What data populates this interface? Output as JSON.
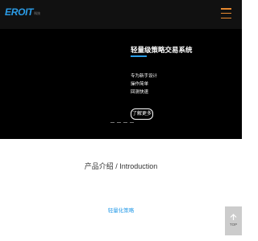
{
  "header": {
    "logo_text": "EROIT",
    "logo_sub": "科技"
  },
  "hero": {
    "title": "轻量级策略交易系统",
    "features": [
      "专为新手设计",
      "操作简单",
      "回测快速"
    ],
    "more_button": "了解更多",
    "accent_color": "#2b9de8"
  },
  "section": {
    "title": "产品介绍 / Introduction",
    "product_link": "轻量化策略"
  },
  "top_button": {
    "label": "TOP",
    "icon": "arrow-up-icon"
  },
  "colors": {
    "brand": "#2b9de8",
    "menu": "#e8892f",
    "dark": "#000000"
  }
}
